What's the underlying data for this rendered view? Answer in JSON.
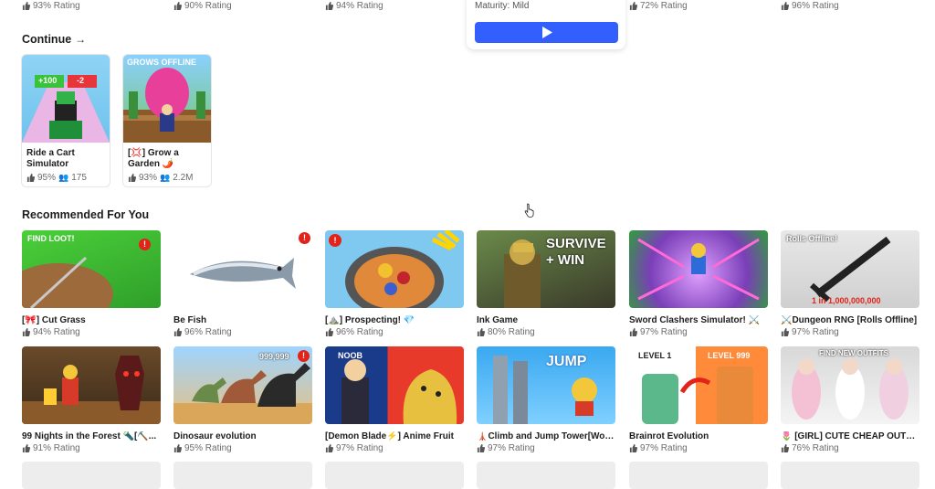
{
  "top_row": {
    "ratings": [
      "93% Rating",
      "90% Rating",
      "94% Rating",
      "72% Rating",
      "96% Rating"
    ],
    "maturity": "Maturity: Mild",
    "play_button_color": "#335fff"
  },
  "continue": {
    "heading": "Continue",
    "items": [
      {
        "title": "Ride a Cart Simulator",
        "rating": "95%",
        "players": "175",
        "thumb_text": [
          "+100",
          "-2"
        ]
      },
      {
        "title": "[💢] Grow a Garden 🌶️",
        "rating": "93%",
        "players": "2.2M",
        "thumb_text": [
          "GROWS OFFLINE"
        ]
      }
    ]
  },
  "recommended": {
    "heading": "Recommended For You",
    "row1": [
      {
        "title": "[🎀] Cut Grass",
        "rating": "94% Rating",
        "thumb_text": "FIND LOOT!"
      },
      {
        "title": "Be Fish",
        "rating": "96% Rating"
      },
      {
        "title": "[⛰️] Prospecting! 💎",
        "rating": "96% Rating"
      },
      {
        "title": "Ink Game",
        "rating": "80% Rating",
        "thumb_text": "SURVIVE + WIN"
      },
      {
        "title": "Sword Clashers Simulator! ⚔️",
        "rating": "97% Rating"
      },
      {
        "title": "⚔️Dungeon RNG [Rolls Offline]",
        "rating": "97% Rating",
        "thumb_text": "Rolls Offline!",
        "thumb_sub": "1 in 1,000,000,000"
      }
    ],
    "row2": [
      {
        "title": "99 Nights in the Forest 🔦[⛏️...",
        "rating": "91% Rating"
      },
      {
        "title": "Dinosaur evolution",
        "rating": "95% Rating",
        "thumb_text": "999,999"
      },
      {
        "title": "[Demon Blade⚡] Anime Fruit",
        "rating": "97% Rating",
        "thumb_text": "NOOB"
      },
      {
        "title": "🗼Climb and Jump Tower[Worl...",
        "rating": "97% Rating",
        "thumb_text": "JUMP"
      },
      {
        "title": "Brainrot Evolution",
        "rating": "97% Rating",
        "thumb_text": "LEVEL 1",
        "thumb_text2": "LEVEL 999"
      },
      {
        "title": "🌷 [GIRL] CUTE CHEAP OUTFITS",
        "rating": "76% Rating",
        "thumb_text": "FIND NEW OUTFITS"
      }
    ]
  }
}
